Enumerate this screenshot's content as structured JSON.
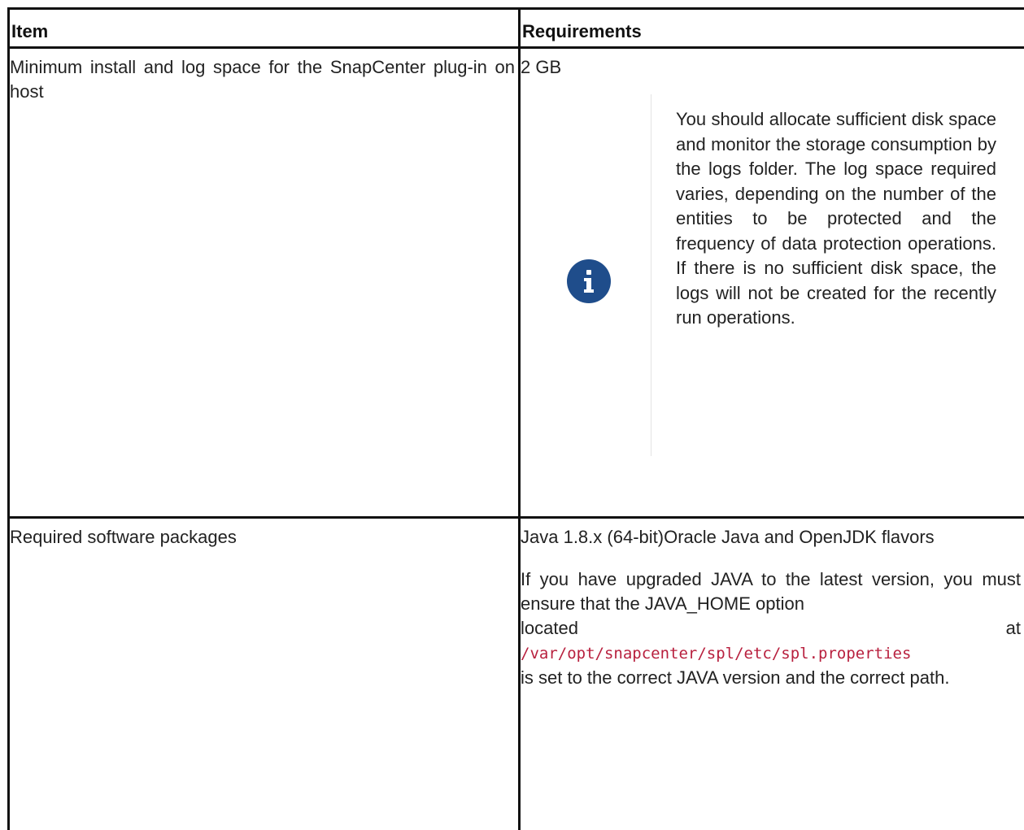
{
  "table": {
    "headers": [
      "Item",
      "Requirements"
    ],
    "rows": [
      {
        "item": "Minimum install and log space for the SnapCenter plug-in on host",
        "requirement": "2 GB",
        "note": "You should allocate sufficient disk space and monitor the storage consumption by the logs folder. The log space required varies, depending on the number of the entities to be protected and the frequency of data protection operations. If there is no sufficient disk space, the logs will not be created for the recently run operations.",
        "note_icon": "info-icon"
      },
      {
        "item": "Required software packages",
        "requirement": "Java 1.8.x (64-bit)Oracle Java and OpenJDK flavors",
        "detail_before": "If you have upgraded JAVA to the latest version, you must ensure that the JAVA_HOME option",
        "detail_located": "located",
        "detail_at": "at",
        "detail_path": "/var/opt/snapcenter/spl/etc/spl.properties",
        "detail_after": "is set to the correct JAVA version and the correct path."
      }
    ]
  },
  "colors": {
    "border": "#111111",
    "info_icon": "#1f4d8b",
    "code_text": "#b8203e"
  }
}
